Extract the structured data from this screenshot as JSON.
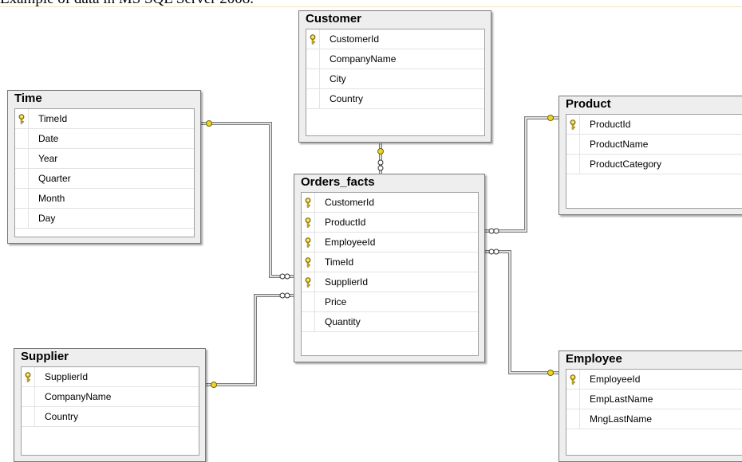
{
  "caption": "Example of data in MS SQL Server 2008.",
  "tables": [
    {
      "name": "Customer",
      "columns": [
        {
          "name": "CustomerId",
          "key": true
        },
        {
          "name": "CompanyName",
          "key": false
        },
        {
          "name": "City",
          "key": false
        },
        {
          "name": "Country",
          "key": false
        }
      ]
    },
    {
      "name": "Time",
      "columns": [
        {
          "name": "TimeId",
          "key": true
        },
        {
          "name": "Date",
          "key": false
        },
        {
          "name": "Year",
          "key": false
        },
        {
          "name": "Quarter",
          "key": false
        },
        {
          "name": "Month",
          "key": false
        },
        {
          "name": "Day",
          "key": false
        }
      ]
    },
    {
      "name": "Product",
      "columns": [
        {
          "name": "ProductId",
          "key": true
        },
        {
          "name": "ProductName",
          "key": false
        },
        {
          "name": "ProductCategory",
          "key": false
        }
      ]
    },
    {
      "name": "Orders_facts",
      "columns": [
        {
          "name": "CustomerId",
          "key": true
        },
        {
          "name": "ProductId",
          "key": true
        },
        {
          "name": "EmployeeId",
          "key": true
        },
        {
          "name": "TimeId",
          "key": true
        },
        {
          "name": "SupplierId",
          "key": true
        },
        {
          "name": "Price",
          "key": false
        },
        {
          "name": "Quantity",
          "key": false
        }
      ]
    },
    {
      "name": "Supplier",
      "columns": [
        {
          "name": "SupplierId",
          "key": true
        },
        {
          "name": "CompanyName",
          "key": false
        },
        {
          "name": "Country",
          "key": false
        }
      ]
    },
    {
      "name": "Employee",
      "columns": [
        {
          "name": "EmployeeId",
          "key": true
        },
        {
          "name": "EmpLastName",
          "key": false
        },
        {
          "name": "MngLastName",
          "key": false
        }
      ]
    }
  ],
  "relationships": [
    {
      "from": "Orders_facts",
      "to": "Customer"
    },
    {
      "from": "Orders_facts",
      "to": "Time"
    },
    {
      "from": "Orders_facts",
      "to": "Product"
    },
    {
      "from": "Orders_facts",
      "to": "Supplier"
    },
    {
      "from": "Orders_facts",
      "to": "Employee"
    }
  ],
  "colors": {
    "key": "#f2d22a",
    "line": "#7a7a7a",
    "header_bg": "#eeeeee"
  }
}
